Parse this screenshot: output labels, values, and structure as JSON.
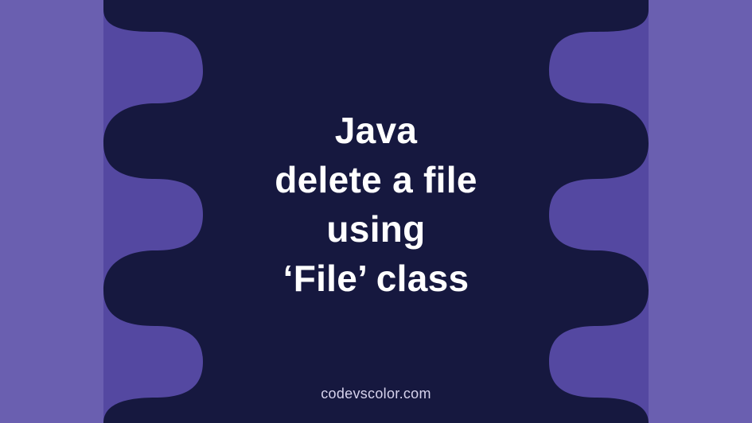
{
  "title": {
    "line1": "Java",
    "line2": "delete a file",
    "line3": "using",
    "line4": "‘File’ class"
  },
  "attribution": "codevscolor.com",
  "colors": {
    "light_purple": "#6a5fb0",
    "mid_purple": "#5448a1",
    "dark_navy": "#16183f",
    "text": "#ffffff",
    "attribution_text": "#d6d2ec"
  }
}
